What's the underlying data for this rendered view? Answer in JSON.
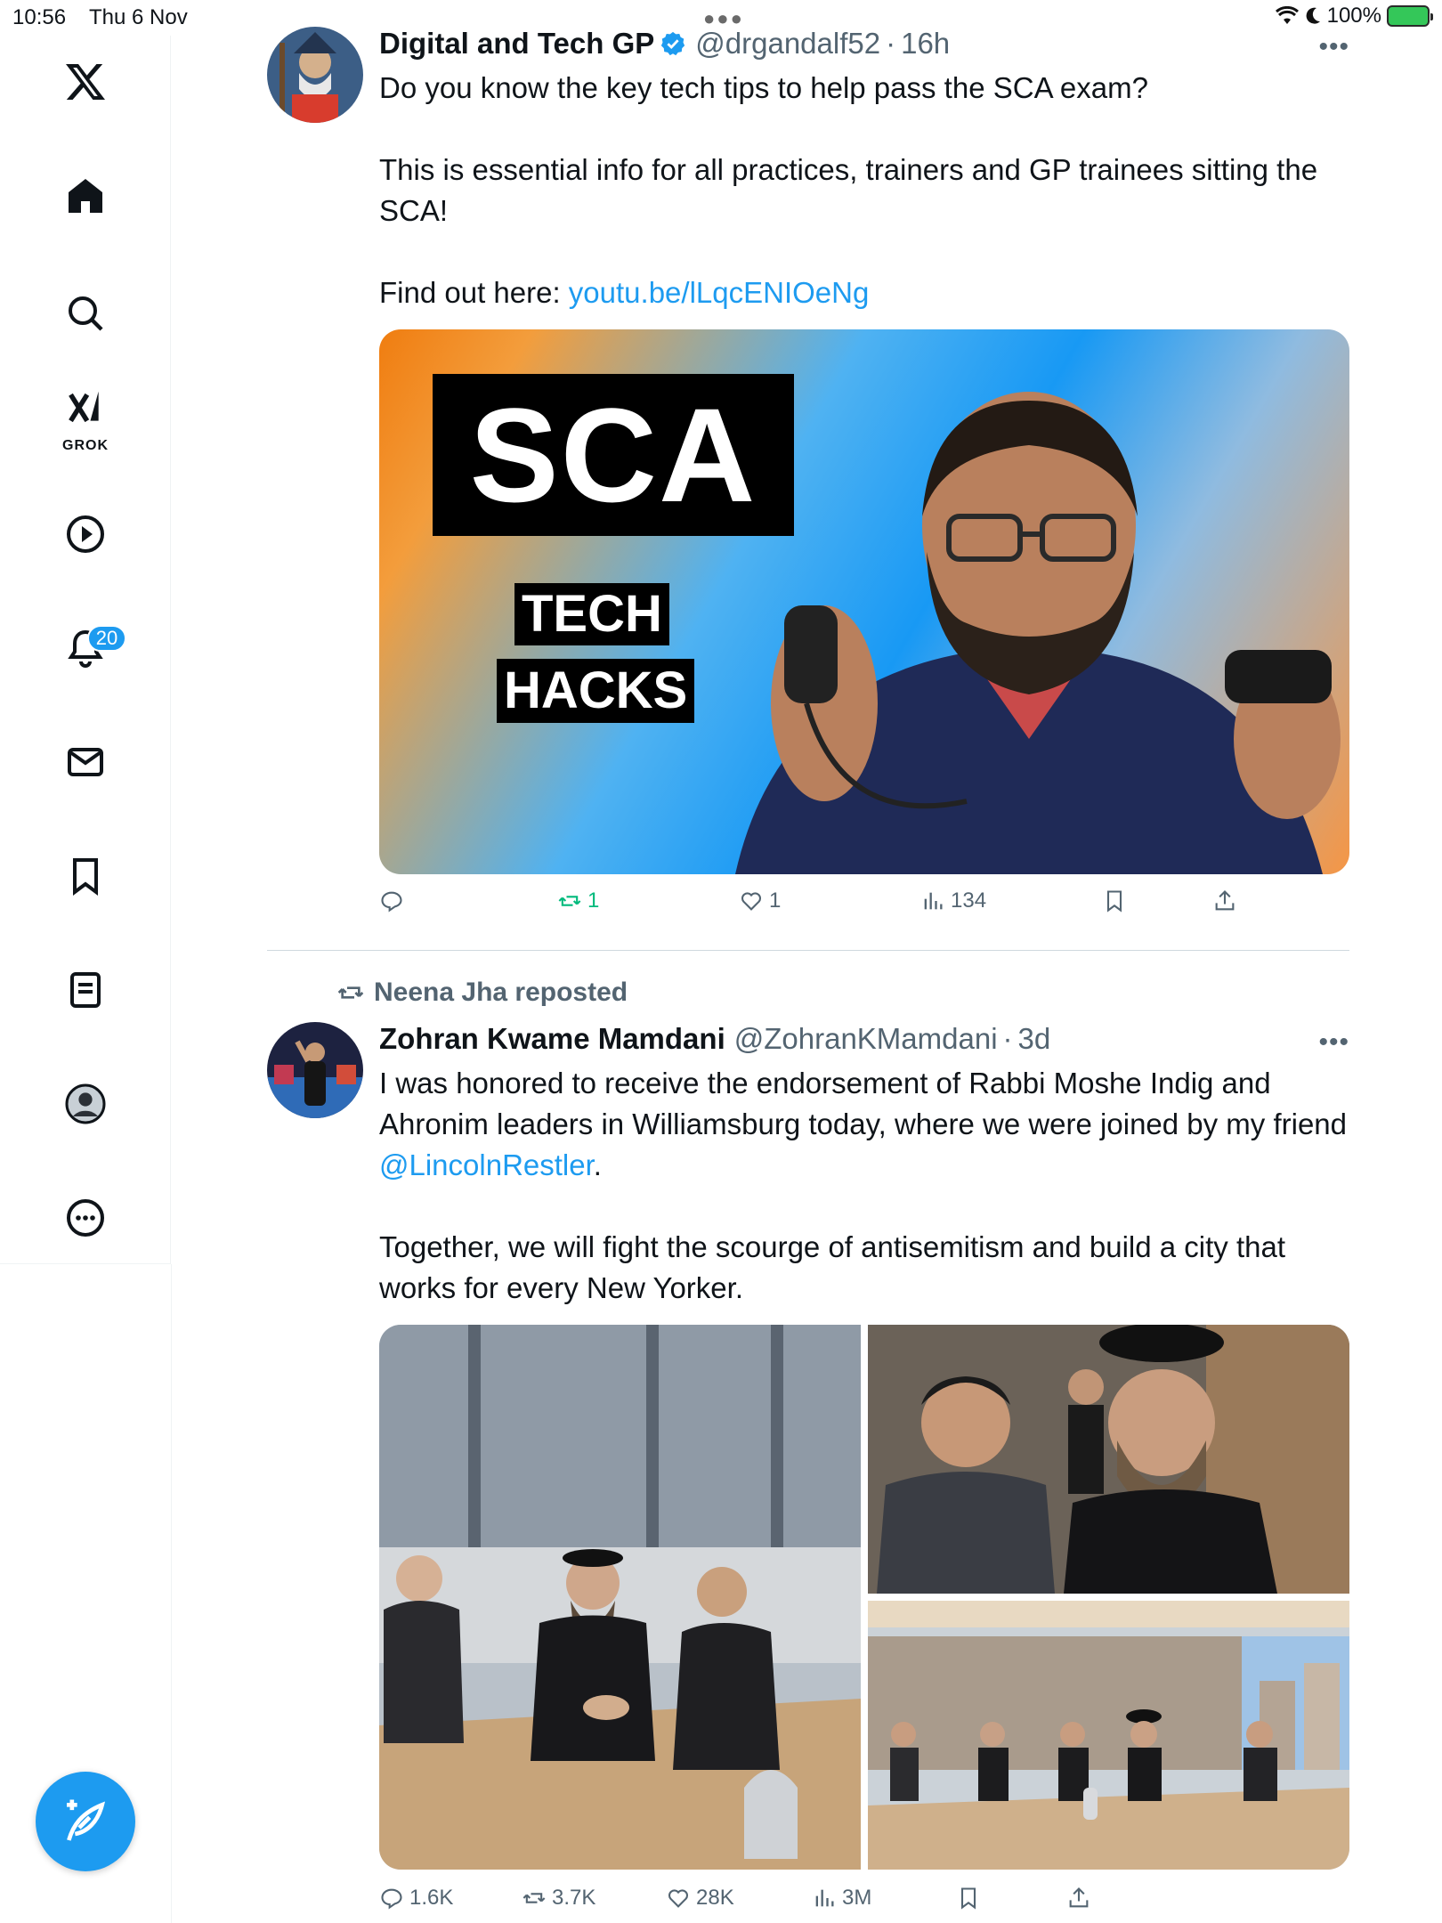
{
  "status_bar": {
    "time": "10:56",
    "date": "Thu 6 Nov",
    "battery": "100%"
  },
  "sidebar": {
    "badge_notifications": "20",
    "grok_label": "GROK"
  },
  "tweets": [
    {
      "name": "Digital and Tech GP",
      "verified": true,
      "handle": "@drgandalf52",
      "time": "16h",
      "text": {
        "p1": "Do you know the key tech tips to help pass the SCA exam?",
        "p2": "This is essential info for all practices, trainers and GP trainees sitting the SCA!",
        "p3_prefix": "Find out here: ",
        "p3_link": "youtu.be/lLqcENIOeNg"
      },
      "media": {
        "line1": "SCA",
        "line2": "TECH",
        "line3": "HACKS"
      },
      "stats": {
        "reposts": "1",
        "likes": "1",
        "views": "134"
      }
    },
    {
      "reposted_by": "Neena Jha reposted",
      "name": "Zohran Kwame Mamdani",
      "handle": "@ZohranKMamdani",
      "time": "3d",
      "text": {
        "p1_prefix": "I was honored to receive the endorsement of Rabbi Moshe Indig and Ahronim leaders in Williamsburg today, where we were joined by my friend ",
        "p1_link": "@LincolnRestler",
        "p1_suffix": ".",
        "p2": "Together, we will fight the scourge of antisemitism and build a city that works for every New Yorker."
      },
      "stats": {
        "replies": "1.6K",
        "reposts": "3.7K",
        "likes": "28K",
        "views": "3M"
      }
    }
  ],
  "colors": {
    "accent": "#1d9bf0",
    "text": "#0f1419",
    "muted": "#536471",
    "repost_active": "#00ba7c"
  }
}
